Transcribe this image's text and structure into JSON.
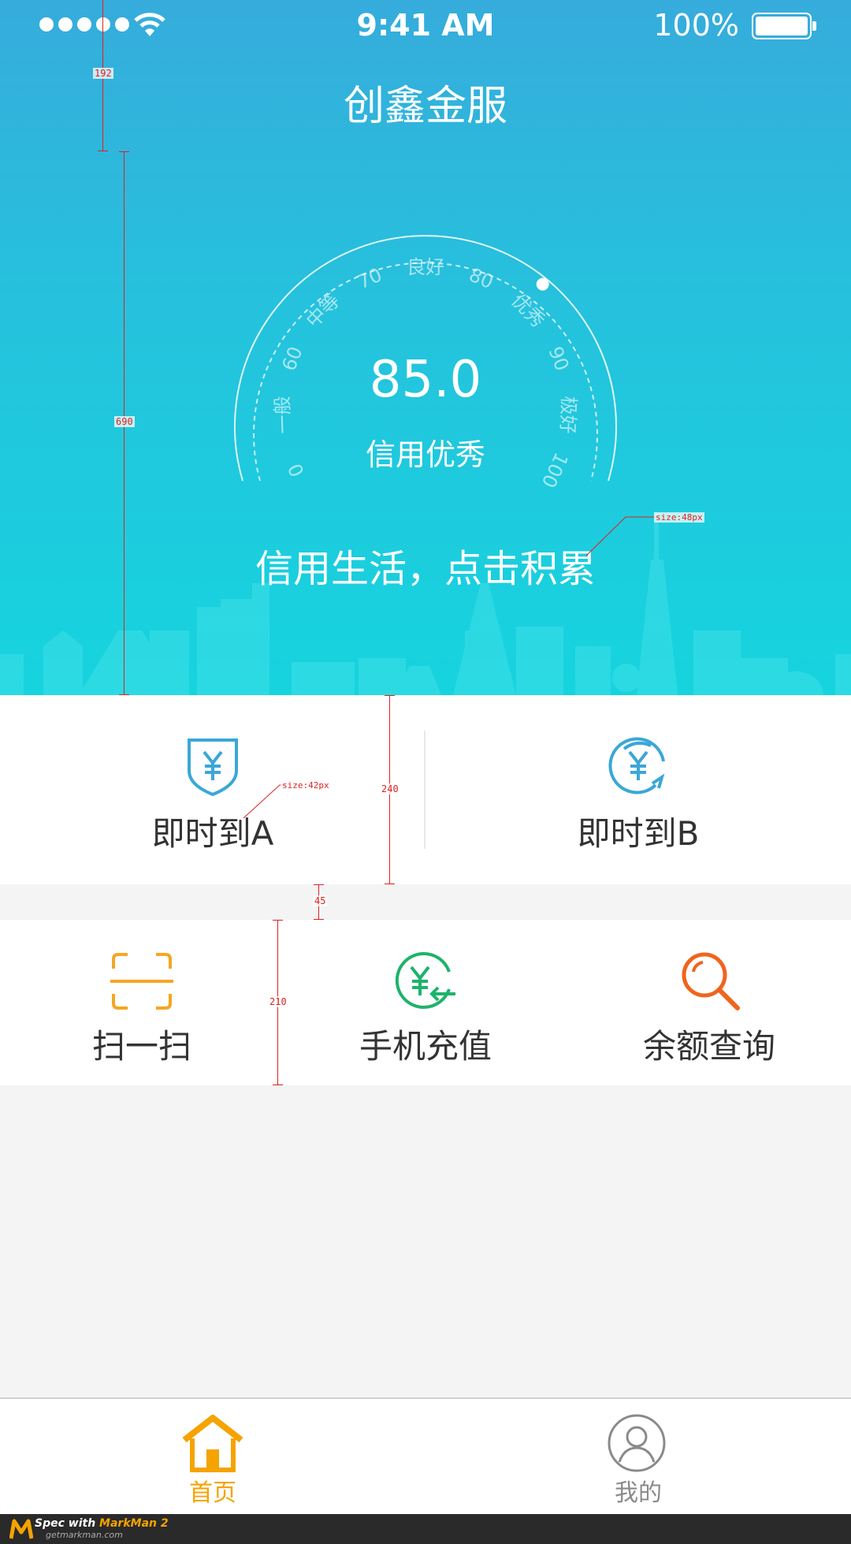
{
  "status_bar": {
    "time": "9:41 AM",
    "battery": "100%",
    "signal_dots": 5
  },
  "header": {
    "title": "创鑫金服"
  },
  "credit": {
    "score": "85.0",
    "score_label": "信用优秀",
    "gauge_labels": [
      "0",
      "一般",
      "60",
      "中等",
      "70",
      "良好",
      "80",
      "优秀",
      "90",
      "极好",
      "100"
    ],
    "level": 85
  },
  "slogan": "信用生活，点击积累",
  "actions": {
    "instant_a": {
      "label": "即时到A",
      "icon": "yuan-shield-icon"
    },
    "instant_b": {
      "label": "即时到B",
      "icon": "yuan-refresh-icon"
    }
  },
  "services": [
    {
      "label": "扫一扫",
      "icon": "scan-icon",
      "color": "#f5a623"
    },
    {
      "label": "手机充值",
      "icon": "yuan-recharge-icon",
      "color": "#1db36b"
    },
    {
      "label": "余额查询",
      "icon": "search-icon",
      "color": "#f0641e"
    }
  ],
  "tabbar": {
    "home": {
      "label": "首页",
      "color": "#f5a300"
    },
    "mine": {
      "label": "我的",
      "color": "#8a8a8a"
    }
  },
  "annotations": {
    "status_header_height": "192",
    "hero_height": "690",
    "slogan_size": "size:48px",
    "action_label_size": "size:42px",
    "action_row_height": "240",
    "gap_height": "45",
    "service_row_height": "210"
  },
  "footer": {
    "brand_prefix": "Spec with ",
    "brand_name": "MarkMan 2",
    "url": "getmarkman.com"
  },
  "colors": {
    "hero_top": "#36acdc",
    "hero_bottom": "#16d4de",
    "measure": "#d22222",
    "blue_icon": "#3aa7d8"
  }
}
